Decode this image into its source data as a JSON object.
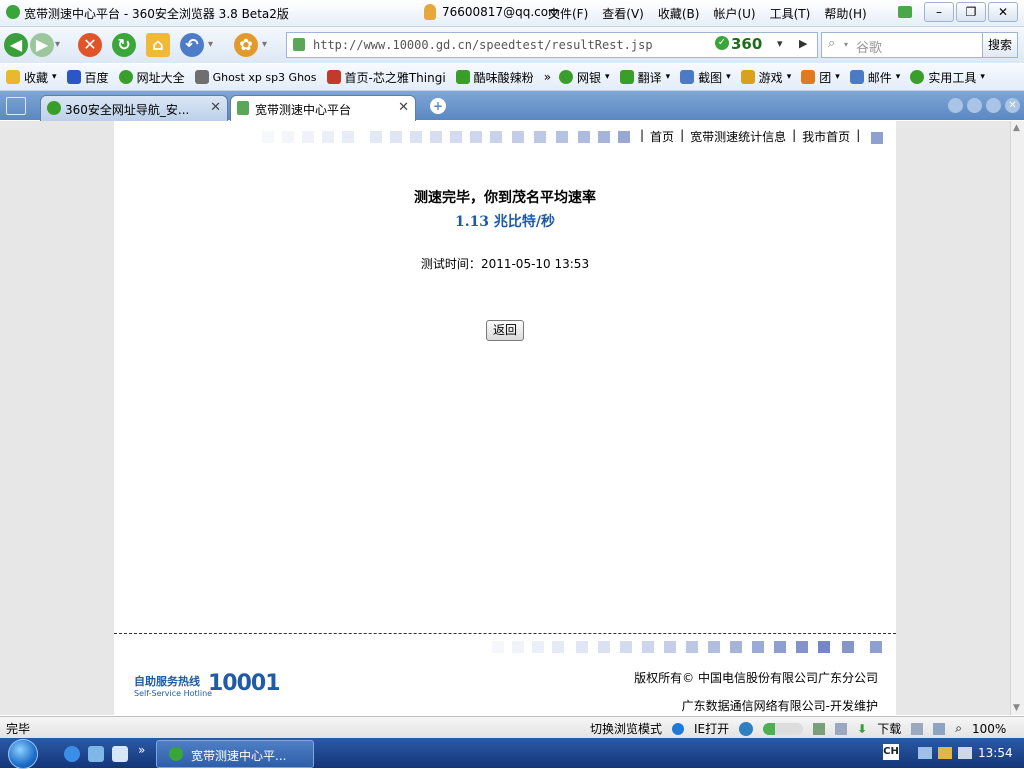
{
  "window": {
    "title": "宽带测速中心平台 - 360安全浏览器 3.8 Beta2版",
    "account": "76600817@qq.com",
    "menu": [
      "文件(F)",
      "查看(V)",
      "收藏(B)",
      "帐户(U)",
      "工具(T)",
      "帮助(H)"
    ],
    "controls": [
      "–",
      "❐",
      "✕"
    ]
  },
  "nav": {
    "url": "http://www.10000.gd.cn/speedtest/resultRest.jsp",
    "security_badge": "360",
    "search_placeholder": "谷歌",
    "search_button": "搜索"
  },
  "favorites": [
    {
      "label": "收藏",
      "color": "#e8b92e"
    },
    {
      "label": "百度",
      "color": "#2a56c6"
    },
    {
      "label": "网址大全",
      "color": "#3a9e2a"
    },
    {
      "label": "Ghost xp sp3 Ghos",
      "color": "#6f6f6f"
    },
    {
      "label": "首页-芯之雅Thingi",
      "color": "#c43a2a"
    },
    {
      "label": "酷味酸辣粉",
      "color": "#3a9e2a"
    },
    {
      "label": "网银",
      "color": "#3a9e2a"
    },
    {
      "label": "翻译",
      "color": "#3a9e2a"
    },
    {
      "label": "截图",
      "color": "#4a7bc4"
    },
    {
      "label": "游戏",
      "color": "#d9a21d"
    },
    {
      "label": "团",
      "color": "#e07a1f"
    },
    {
      "label": "邮件",
      "color": "#4a7bc4"
    },
    {
      "label": "实用工具",
      "color": "#3a9e2a"
    }
  ],
  "tabs": [
    {
      "label": "360安全网址导航_安...",
      "active": false
    },
    {
      "label": "宽带测速中心平台",
      "active": true
    }
  ],
  "page": {
    "top_links": [
      "首页",
      "宽带测速统计信息",
      "我市首页"
    ],
    "result_title": "测速完毕，你到茂名平均速率",
    "result_speed": "1.13 兆比特/秒",
    "test_time_label": "测试时间：",
    "test_time": "2011-05-10 13:53",
    "return_button": "返回",
    "hotline_cn": "自助服务热线",
    "hotline_en": "Self-Service Hotline",
    "hotline_number": "10001",
    "copyright": "版权所有© 中国电信股份有限公司广东分公司",
    "maintainer": "广东数据通信网络有限公司-开发维护"
  },
  "status": {
    "left": "完毕",
    "mode": "切换浏览模式",
    "ie_open": "IE打开",
    "download": "下载",
    "zoom": "100%"
  },
  "taskbar": {
    "item": "宽带测速中心平...",
    "lang": "CH",
    "clock": "13:54"
  },
  "colors": {
    "accent": "#1e5aa8",
    "tabbar": "#6a95cc",
    "taskbar": "#1f4a93"
  }
}
